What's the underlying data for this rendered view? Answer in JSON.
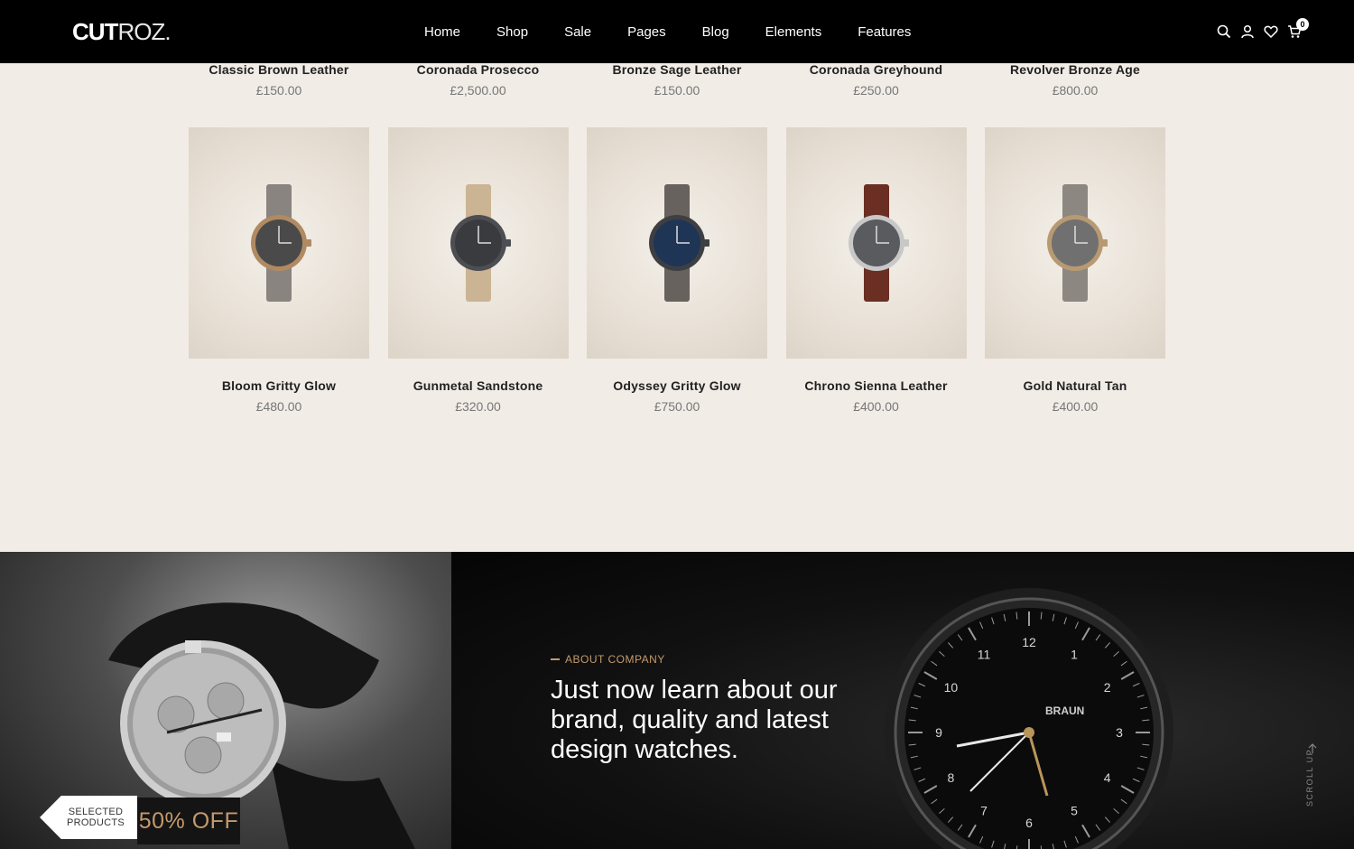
{
  "header": {
    "logo_bold": "CUT",
    "logo_light": "ROZ.",
    "nav": [
      "Home",
      "Shop",
      "Sale",
      "Pages",
      "Blog",
      "Elements",
      "Features"
    ],
    "cart_count": "0"
  },
  "products_row1": [
    {
      "name": "Classic Brown Leather",
      "price": "£150.00"
    },
    {
      "name": "Coronada Prosecco",
      "price": "£2,500.00"
    },
    {
      "name": "Bronze Sage Leather",
      "price": "£150.00"
    },
    {
      "name": "Coronada Greyhound",
      "price": "£250.00"
    },
    {
      "name": "Revolver Bronze Age",
      "price": "£800.00"
    }
  ],
  "products_row2": [
    {
      "name": "Bloom Gritty Glow",
      "price": "£480.00",
      "strap_color": "#8a8480",
      "dial_color": "#4a4a4a",
      "case_color": "#b08a62"
    },
    {
      "name": "Gunmetal Sandstone",
      "price": "£320.00",
      "strap_color": "#cbb493",
      "dial_color": "#3a3b3e",
      "case_color": "#4d4e52"
    },
    {
      "name": "Odyssey Gritty Glow",
      "price": "£750.00",
      "strap_color": "#67625d",
      "dial_color": "#1f3556",
      "case_color": "#3e3f42"
    },
    {
      "name": "Chrono Sienna Leather",
      "price": "£400.00",
      "strap_color": "#6a2f22",
      "dial_color": "#5a5b5e",
      "case_color": "#c8c8c8"
    },
    {
      "name": "Gold Natural Tan",
      "price": "£400.00",
      "strap_color": "#8c8780",
      "dial_color": "#707070",
      "case_color": "#b89a72"
    }
  ],
  "promo": {
    "tag_line1": "SELECTED",
    "tag_line2": "PRODUCTS",
    "discount": "50% OFF"
  },
  "about": {
    "eyebrow": "ABOUT COMPANY",
    "headline": "Just now learn about our brand, quality and latest design watches.",
    "dial_brand": "BRAUN",
    "dial_numbers": [
      "12",
      "1",
      "2",
      "3",
      "4",
      "5",
      "6",
      "7",
      "8",
      "9",
      "10",
      "11"
    ],
    "scroll_label": "SCROLL UP"
  },
  "colors": {
    "accent": "#c49a6c",
    "page_bg": "#f1ece6",
    "header_bg": "#000000"
  }
}
